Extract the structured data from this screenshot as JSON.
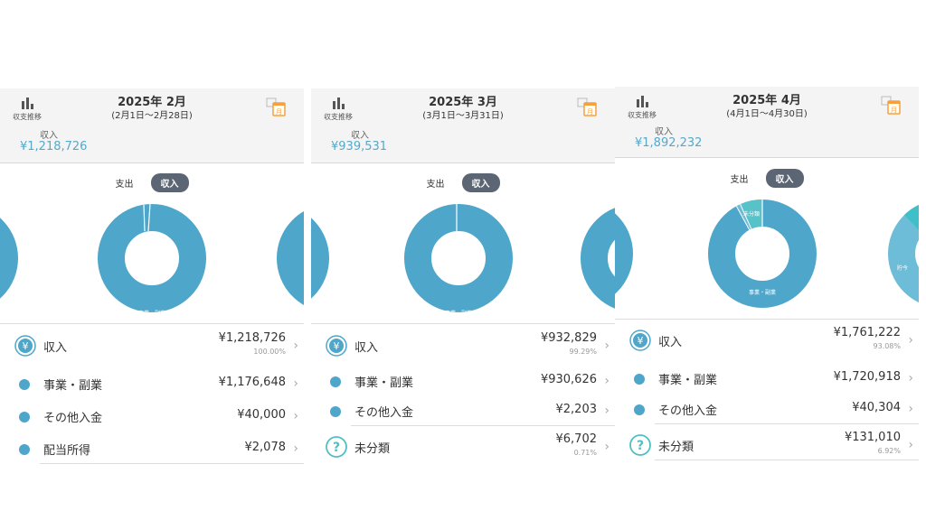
{
  "colors": {
    "accent": "#4ea6ca",
    "accent_light": "#6dbcd8",
    "teal": "#3fbfc7",
    "toggle_bg": "#5c6573",
    "header_bg": "#f4f4f4",
    "calendar_orange": "#f5a03c"
  },
  "common": {
    "trend_label": "収支推移",
    "income_label": "収入",
    "expense_tab": "支出",
    "income_tab": "収入",
    "yen_icon_glyph": "¥",
    "unclassified_icon_glyph": "?",
    "chevron": "›"
  },
  "panels": [
    {
      "title": "2025年 2月",
      "range": "(2月1日〜2月28日)",
      "income_total": "¥1,218,726",
      "donut": {
        "label": "事業・副業"
      },
      "rows": [
        {
          "icon": "yen-icon",
          "label": "収入",
          "value": "¥1,218,726",
          "pct": "100.00%"
        },
        {
          "icon": "dot",
          "label": "事業・副業",
          "value": "¥1,176,648"
        },
        {
          "icon": "dot",
          "label": "その他入金",
          "value": "¥40,000"
        },
        {
          "icon": "dot",
          "label": "配当所得",
          "value": "¥2,078"
        }
      ]
    },
    {
      "title": "2025年 3月",
      "range": "(3月1日〜3月31日)",
      "income_total": "¥939,531",
      "donut": {
        "label": "事業・副業"
      },
      "rows": [
        {
          "icon": "yen-icon",
          "label": "収入",
          "value": "¥932,829",
          "pct": "99.29%"
        },
        {
          "icon": "dot",
          "label": "事業・副業",
          "value": "¥930,626"
        },
        {
          "icon": "dot",
          "label": "その他入金",
          "value": "¥2,203"
        },
        {
          "icon": "question-icon",
          "label": "未分類",
          "value": "¥6,702",
          "pct": "0.71%"
        }
      ]
    },
    {
      "title": "2025年 4月",
      "range": "(4月1日〜4月30日)",
      "income_total": "¥1,892,232",
      "donut": {
        "label": "事業・副業",
        "label2": "未分類",
        "right_label": "貯今"
      },
      "rows": [
        {
          "icon": "yen-icon",
          "label": "収入",
          "value": "¥1,761,222",
          "pct": "93.08%"
        },
        {
          "icon": "dot",
          "label": "事業・副業",
          "value": "¥1,720,918"
        },
        {
          "icon": "dot",
          "label": "その他入金",
          "value": "¥40,304"
        },
        {
          "icon": "question-icon",
          "label": "未分類",
          "value": "¥131,010",
          "pct": "6.92%"
        }
      ]
    }
  ]
}
